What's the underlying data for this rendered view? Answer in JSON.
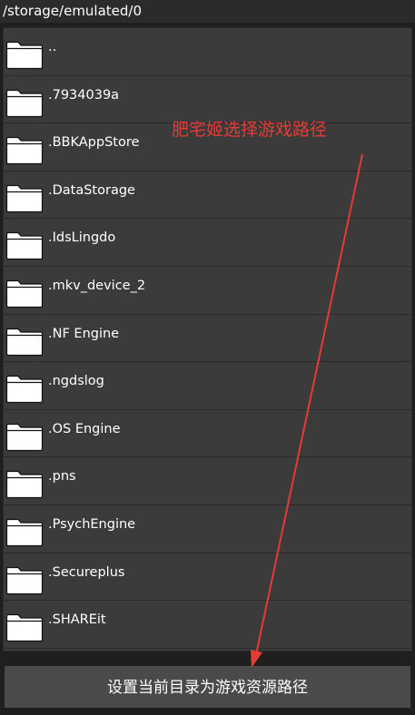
{
  "path_bar": {
    "path": "/storage/emulated/0"
  },
  "file_list": {
    "items": [
      {
        "name": "..",
        "icon": "folder-icon"
      },
      {
        "name": ".7934039a",
        "icon": "folder-icon"
      },
      {
        "name": ".BBKAppStore",
        "icon": "folder-icon"
      },
      {
        "name": ".DataStorage",
        "icon": "folder-icon"
      },
      {
        "name": ".IdsLingdo",
        "icon": "folder-icon"
      },
      {
        "name": ".mkv_device_2",
        "icon": "folder-icon"
      },
      {
        "name": ".NF Engine",
        "icon": "folder-icon"
      },
      {
        "name": ".ngdslog",
        "icon": "folder-icon"
      },
      {
        "name": ".OS Engine",
        "icon": "folder-icon"
      },
      {
        "name": ".pns",
        "icon": "folder-icon"
      },
      {
        "name": ".PsychEngine",
        "icon": "folder-icon"
      },
      {
        "name": ".Secureplus",
        "icon": "folder-icon"
      },
      {
        "name": ".SHAREit",
        "icon": "folder-icon"
      }
    ]
  },
  "annotation": {
    "text": "肥宅姬选择游戏路径",
    "color": "#e53a35"
  },
  "action_button": {
    "label": "设置当前目录为游戏资源路径"
  },
  "colors": {
    "background": "#1f1f1f",
    "list_background": "#3b3b3b",
    "button_background": "#4a4a4a",
    "text": "#ffffff"
  }
}
